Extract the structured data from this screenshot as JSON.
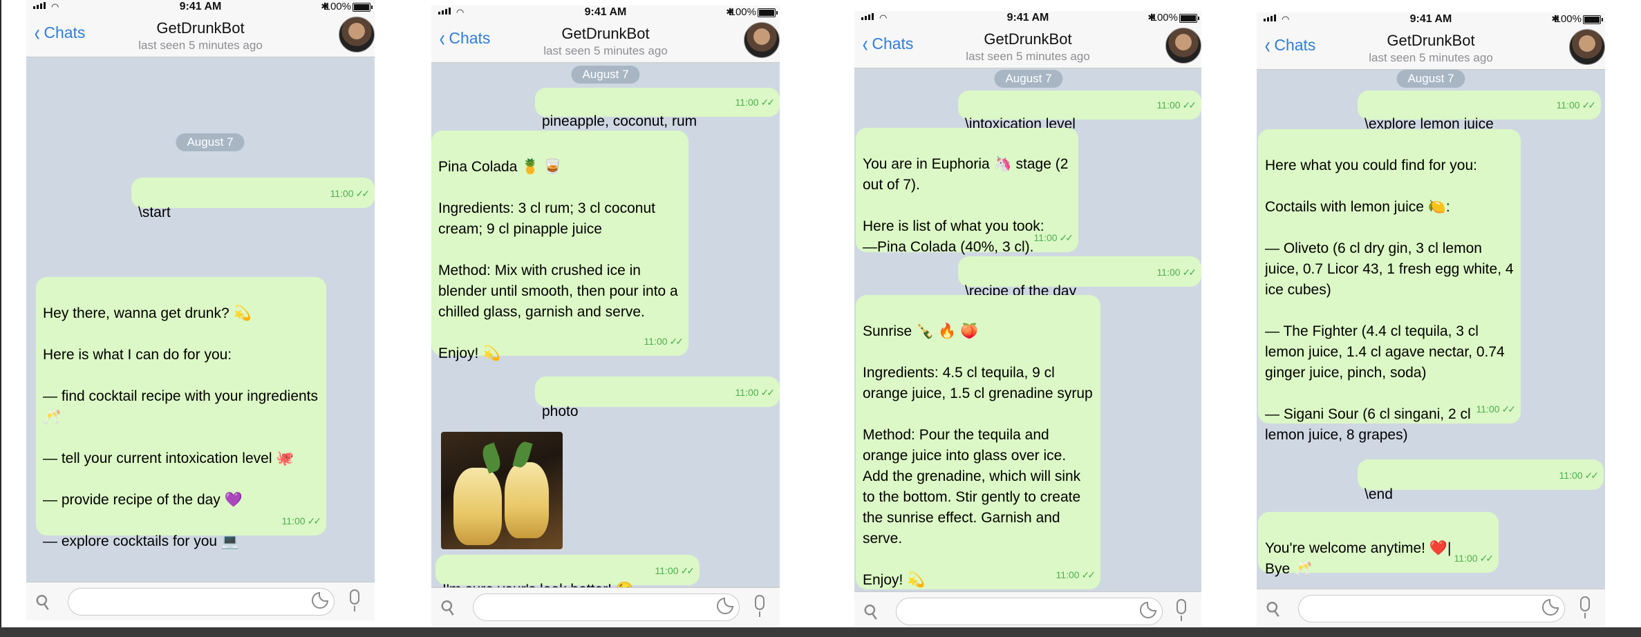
{
  "common": {
    "time": "9:41 AM",
    "battery": "100%",
    "back_label": "Chats",
    "bot_name": "GetDrunkBot",
    "last_seen": "last seen 5 minutes ago",
    "date": "August 7",
    "msg_time": "11:00"
  },
  "screen1": {
    "msg_start": "\\start",
    "msg_welcome": "Hey there, wanna get drunk? 💫\n\nHere is what I can do for you:\n\n— find cocktail recipe with your ingredients 🥂\n\n— tell your current intoxication level 🐙\n\n— provide recipe of the day 💜\n\n— explore cocktails for you 💻"
  },
  "screen2": {
    "msg_ingredients": "pineapple, coconut, rum",
    "msg_recipe": "Pina Colada 🍍 🥃\n\nIngredients: 3 cl rum; 3 cl coconut cream; 9 cl pinapple juice\n\nMethod: Mix with crushed ice in blender until smooth, then pour into a chilled glass, garnish and serve.\n\nEnjoy! 💫",
    "msg_photo": "photo",
    "msg_caption": "I'm sure your's look better! 😉"
  },
  "screen3": {
    "msg_intox": "\\intoxication level",
    "msg_euphoria": "You are in Euphoria 🦄 stage (2 out of 7).\n\nHere is list of what you took:\n—Pina Colada (40%, 3 cl).",
    "msg_recipe_day": "\\recipe of the day",
    "msg_sunrise": "Sunrise 🍾 🔥 🍑\n\nIngredients: 4.5 cl tequila, 9 cl orange juice, 1.5 cl grenadine syrup\n\nMethod: Pour the tequila and orange juice into glass over ice. Add the grenadine, which will sink to the bottom. Stir gently to create the sunrise effect. Garnish and serve.\n\nEnjoy! 💫"
  },
  "screen4": {
    "msg_explore": "\\explore lemon juice",
    "msg_found": "Here what you could find for you:\n\nCoctails with lemon juice 🍋:\n\n— Oliveto (6 cl dry gin, 3 cl lemon juice, 0.7 Licor 43, 1 fresh egg white, 4 ice cubes)\n\n— The Fighter (4.4 cl tequila, 3 cl lemon juice, 1.4 cl agave nectar, 0.74 ginger juice, pinch, soda)\n\n— Sigani Sour (6 cl singani, 2 cl lemon juice, 8 grapes)",
    "msg_end": "\\end",
    "msg_bye": "You're welcome anytime! ❤️|\nBye 🥂"
  }
}
